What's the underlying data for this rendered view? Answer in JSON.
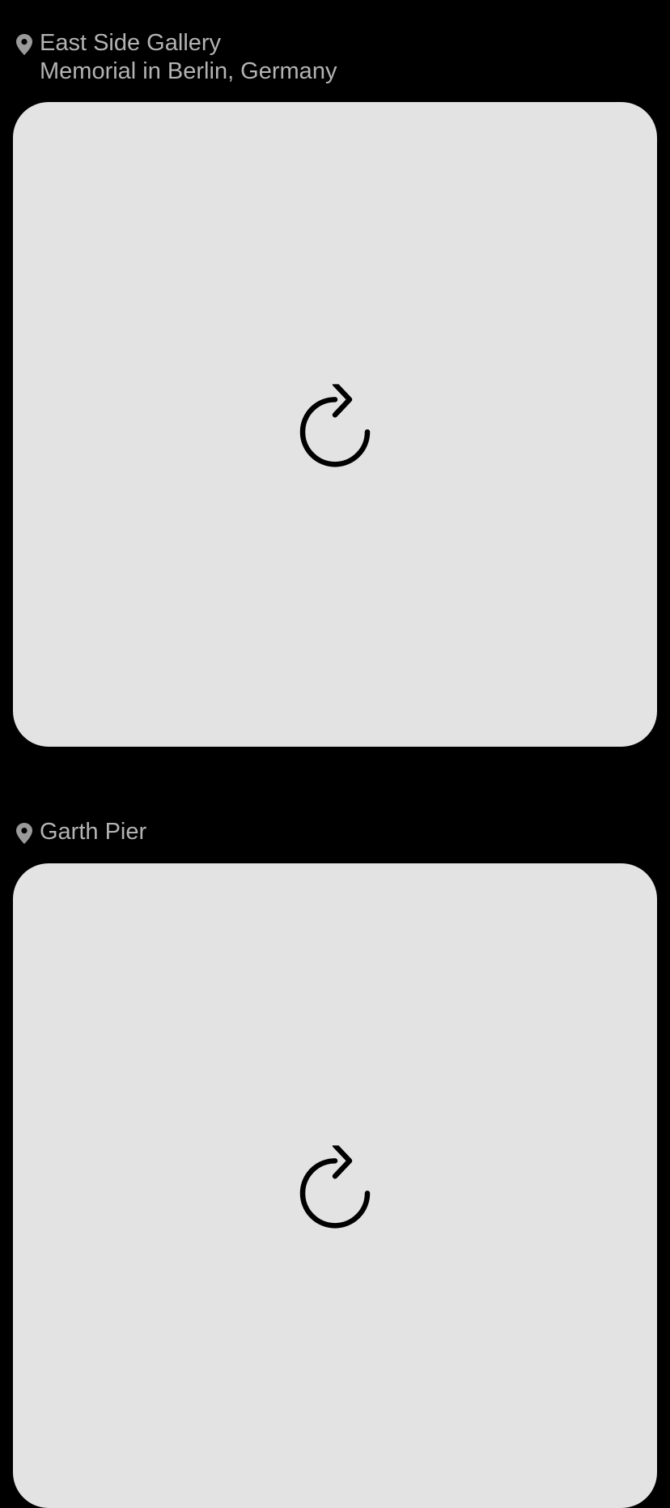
{
  "posts": [
    {
      "location": {
        "icon": "map-pin-icon",
        "name": "East Side Gallery",
        "subtitle": "Memorial in Berlin, Germany"
      },
      "media": {
        "state": "failed-to-load",
        "action_icon": "reload-icon"
      }
    },
    {
      "location": {
        "icon": "map-pin-icon",
        "name": "Garth Pier",
        "subtitle": ""
      },
      "media": {
        "state": "failed-to-load",
        "action_icon": "reload-icon"
      }
    }
  ],
  "colors": {
    "background": "#000000",
    "card": "#e3e3e3",
    "location_text": "#b3b3b3",
    "icon": "#000000"
  }
}
